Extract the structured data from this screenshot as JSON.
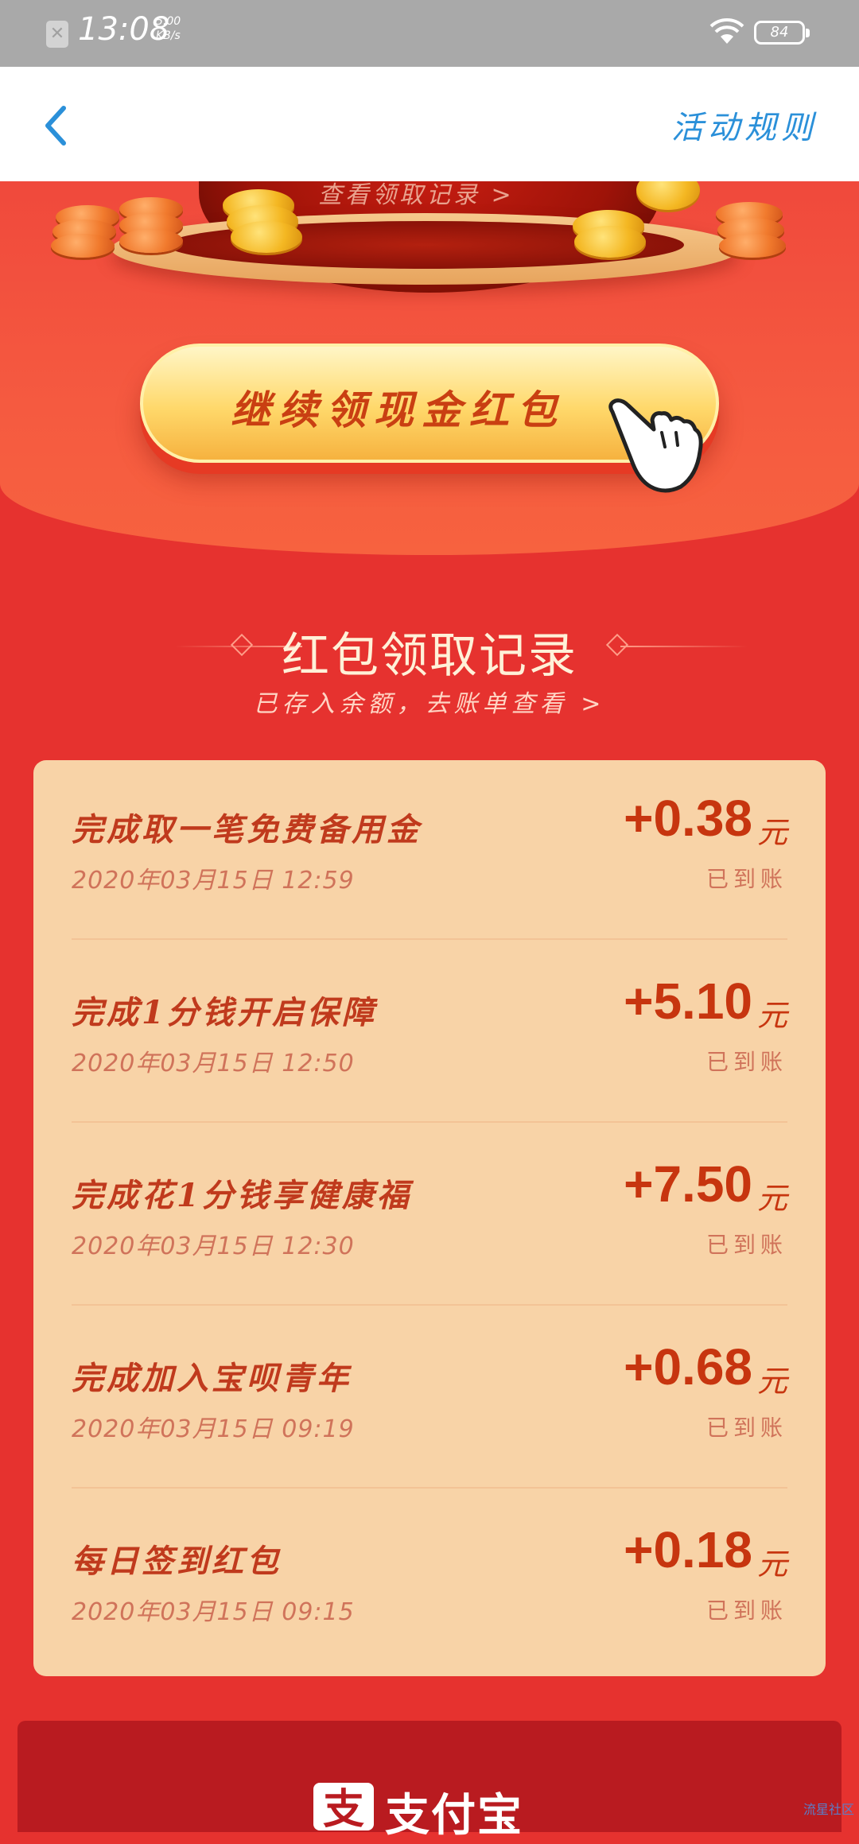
{
  "status_bar": {
    "time": "13:08",
    "net_speed": "5.00 KB/s",
    "battery": "84"
  },
  "header": {
    "rules_label": "活动规则"
  },
  "hero": {
    "view_records_text": "查看领取记录 >",
    "cta_label": "继续领现金红包"
  },
  "records_section": {
    "title": "红包领取记录",
    "subtitle": "已存入余额，去账单查看 >",
    "items": [
      {
        "title": "完成取一笔免费备用金",
        "time": "2020年03月15日  12:59",
        "amount": "+0.38",
        "unit": "元",
        "status": "已到账"
      },
      {
        "title": "完成1分钱开启保障",
        "time": "2020年03月15日  12:50",
        "amount": "+5.10",
        "unit": "元",
        "status": "已到账"
      },
      {
        "title": "完成花1分钱享健康福",
        "time": "2020年03月15日  12:30",
        "amount": "+7.50",
        "unit": "元",
        "status": "已到账"
      },
      {
        "title": "完成加入宝呗青年",
        "time": "2020年03月15日  09:19",
        "amount": "+0.68",
        "unit": "元",
        "status": "已到账"
      },
      {
        "title": "每日签到红包",
        "time": "2020年03月15日  09:15",
        "amount": "+0.18",
        "unit": "元",
        "status": "已到账"
      }
    ]
  },
  "footer": {
    "logo_glyph": "支",
    "brand": "支付宝",
    "watermark": "流星社区"
  },
  "colors": {
    "page_red": "#e6322f",
    "card_bg": "#f8d3a7",
    "amount_red": "#c7350f",
    "link_blue": "#2b90d9"
  }
}
